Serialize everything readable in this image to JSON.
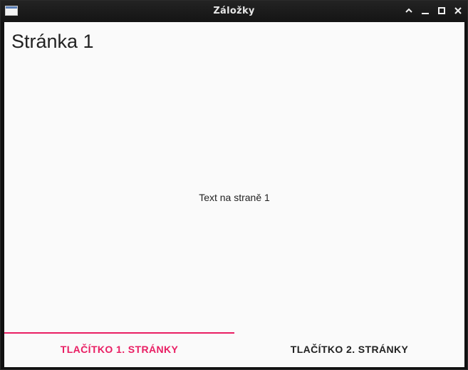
{
  "window": {
    "title": "Záložky"
  },
  "page": {
    "title": "Stránka 1",
    "text": "Text na straně 1"
  },
  "tabs": [
    {
      "label": "TLAČÍTKO 1. STRÁNKY",
      "selected": true
    },
    {
      "label": "TLAČÍTKO 2. STRÁNKY",
      "selected": false
    }
  ],
  "colors": {
    "accent": "#e91e63",
    "background": "#fafafa",
    "titlebar": "#1a1a1a"
  }
}
